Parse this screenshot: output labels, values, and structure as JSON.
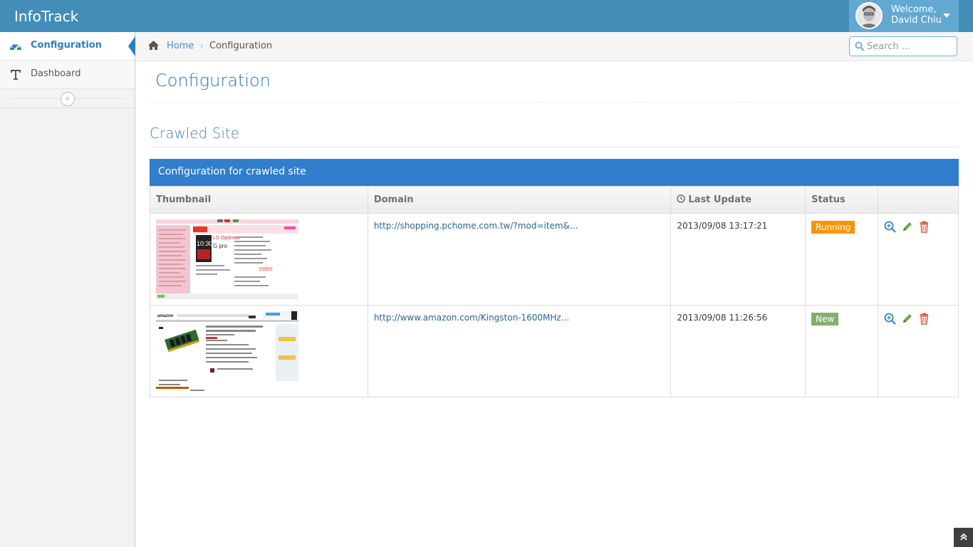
{
  "app": {
    "brand": "InfoTrack"
  },
  "user": {
    "welcome": "Welcome,",
    "name": "David Chiu"
  },
  "sidebar": {
    "items": [
      {
        "label": "Configuration",
        "icon": "tachometer-icon",
        "active": true
      },
      {
        "label": "Dashboard",
        "icon": "text-icon",
        "active": false
      }
    ],
    "collapse_glyph": "«"
  },
  "breadcrumb": {
    "home": "Home",
    "separator": "›",
    "current": "Configuration"
  },
  "search": {
    "placeholder": "Search ..."
  },
  "page": {
    "title": "Configuration",
    "section_title": "Crawled Site"
  },
  "table": {
    "header": "Configuration for crawled site",
    "columns": [
      "Thumbnail",
      "Domain",
      "Last Update",
      "Status",
      ""
    ],
    "rows": [
      {
        "domain": "http://shopping.pchome.com.tw/?mod=item&...",
        "last_update": "2013/09/08 13:17:21",
        "status": "Running",
        "status_color": "#f89406"
      },
      {
        "domain": "http://www.amazon.com/Kingston-1600MHz...",
        "last_update": "2013/09/08 11:26:56",
        "status": "New",
        "status_color": "#82af6f"
      }
    ]
  },
  "colors": {
    "navbar": "#438eb9",
    "accent": "#307ecc",
    "link": "#2a6496"
  },
  "scroll_top": {
    "glyph": "»"
  }
}
